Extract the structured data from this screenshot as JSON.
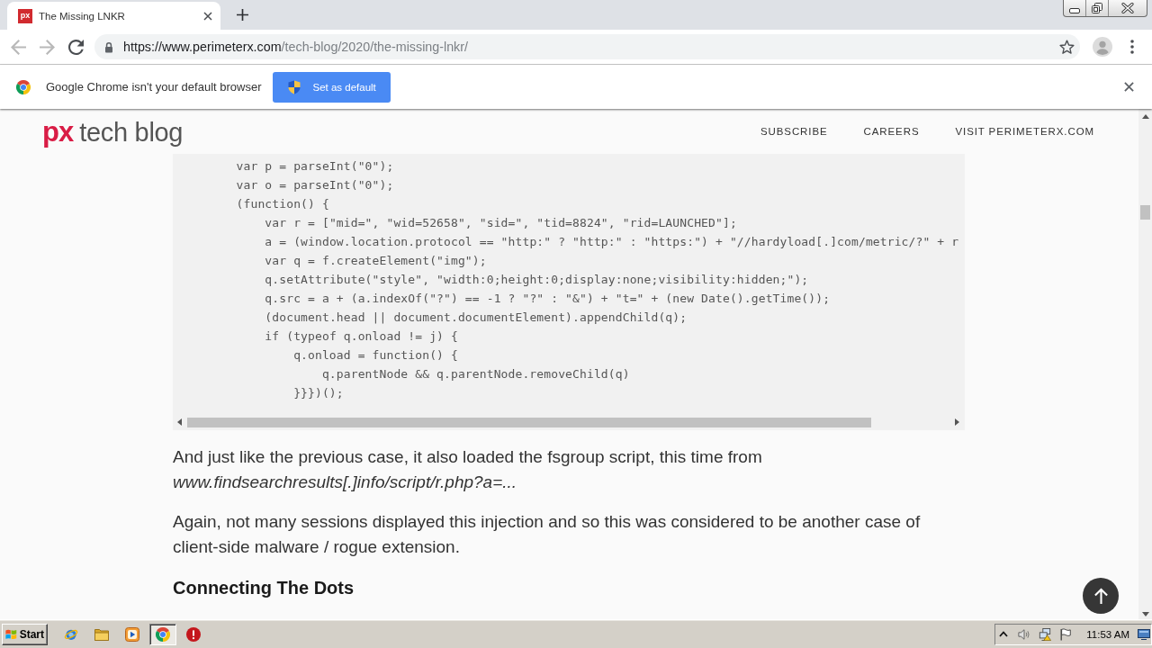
{
  "browser": {
    "tabs": [
      {
        "favicon_text": "px",
        "title": "The Missing LNKR",
        "selected": true
      }
    ],
    "nav": [
      {
        "kind": "back",
        "disabled": true
      },
      {
        "kind": "forward",
        "disabled": true
      },
      {
        "kind": "reload",
        "disabled": false
      }
    ],
    "url": {
      "host": "https://www.perimeterx.com",
      "path": "/tech-blog/2020/the-missing-lnkr/"
    }
  },
  "infobar": {
    "message": "Google Chrome isn't your default browser",
    "button": "Set as default"
  },
  "blog_header": {
    "logo_mark": "px",
    "logo_text": "tech blog",
    "nav": [
      "SUBSCRIBE",
      "CAREERS",
      "VISIT PERIMETERX.COM"
    ]
  },
  "article": {
    "code_lines": [
      "        var p = parseInt(\"0\");",
      "        var o = parseInt(\"0\");",
      "        (function() {",
      "            var r = [\"mid=\", \"wid=52658\", \"sid=\", \"tid=8824\", \"rid=LAUNCHED\"];",
      "            a = (window.location.protocol == \"http:\" ? \"http:\" : \"https:\") + \"//hardyload[.]com/metric/?\" + r",
      "            var q = f.createElement(\"img\");",
      "            q.setAttribute(\"style\", \"width:0;height:0;display:none;visibility:hidden;\");",
      "            q.src = a + (a.indexOf(\"?\") == -1 ? \"?\" : \"&\") + \"t=\" + (new Date().getTime());",
      "            (document.head || document.documentElement).appendChild(q);",
      "            if (typeof q.onload != j) {",
      "                q.onload = function() {",
      "                    q.parentNode && q.parentNode.removeChild(q)",
      "                }}})();"
    ],
    "paragraphs": [
      "And just like the previous case, it also loaded the fsgroup script, this time from *www.findsearchresults[.]info/script/r.php?a=...*",
      "Again, not many sessions displayed this injection and so this was considered to be another case of client-side malware / rogue extension."
    ],
    "heading": "Connecting The Dots"
  },
  "taskbar": {
    "start": "Start",
    "apps": [
      {
        "kind": "globe",
        "selected": false
      },
      {
        "kind": "folder",
        "selected": false
      },
      {
        "kind": "player",
        "selected": false
      },
      {
        "kind": "browser",
        "selected": true
      },
      {
        "kind": "alert",
        "selected": false
      }
    ],
    "clock": "11:53 AM"
  }
}
